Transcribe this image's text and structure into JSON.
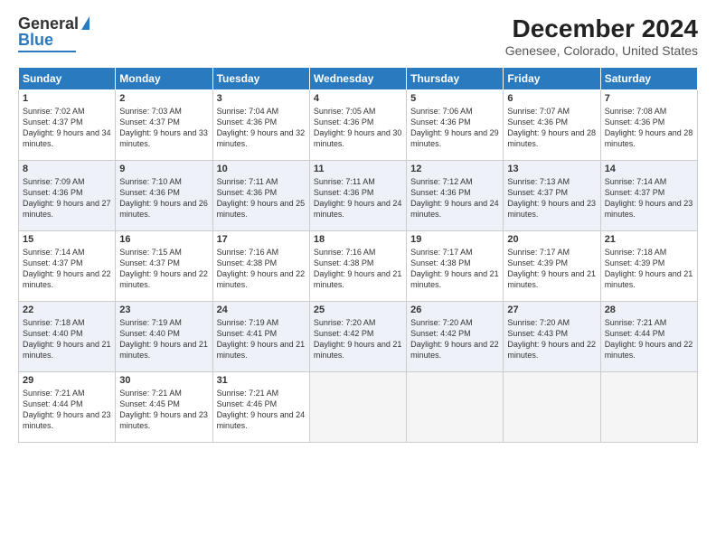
{
  "logo": {
    "line1": "General",
    "line2": "Blue"
  },
  "title": "December 2024",
  "subtitle": "Genesee, Colorado, United States",
  "days_of_week": [
    "Sunday",
    "Monday",
    "Tuesday",
    "Wednesday",
    "Thursday",
    "Friday",
    "Saturday"
  ],
  "weeks": [
    [
      {
        "day": "1",
        "sunrise": "7:02 AM",
        "sunset": "4:37 PM",
        "daylight": "9 hours and 34 minutes."
      },
      {
        "day": "2",
        "sunrise": "7:03 AM",
        "sunset": "4:37 PM",
        "daylight": "9 hours and 33 minutes."
      },
      {
        "day": "3",
        "sunrise": "7:04 AM",
        "sunset": "4:36 PM",
        "daylight": "9 hours and 32 minutes."
      },
      {
        "day": "4",
        "sunrise": "7:05 AM",
        "sunset": "4:36 PM",
        "daylight": "9 hours and 30 minutes."
      },
      {
        "day": "5",
        "sunrise": "7:06 AM",
        "sunset": "4:36 PM",
        "daylight": "9 hours and 29 minutes."
      },
      {
        "day": "6",
        "sunrise": "7:07 AM",
        "sunset": "4:36 PM",
        "daylight": "9 hours and 28 minutes."
      },
      {
        "day": "7",
        "sunrise": "7:08 AM",
        "sunset": "4:36 PM",
        "daylight": "9 hours and 28 minutes."
      }
    ],
    [
      {
        "day": "8",
        "sunrise": "7:09 AM",
        "sunset": "4:36 PM",
        "daylight": "9 hours and 27 minutes."
      },
      {
        "day": "9",
        "sunrise": "7:10 AM",
        "sunset": "4:36 PM",
        "daylight": "9 hours and 26 minutes."
      },
      {
        "day": "10",
        "sunrise": "7:11 AM",
        "sunset": "4:36 PM",
        "daylight": "9 hours and 25 minutes."
      },
      {
        "day": "11",
        "sunrise": "7:11 AM",
        "sunset": "4:36 PM",
        "daylight": "9 hours and 24 minutes."
      },
      {
        "day": "12",
        "sunrise": "7:12 AM",
        "sunset": "4:36 PM",
        "daylight": "9 hours and 24 minutes."
      },
      {
        "day": "13",
        "sunrise": "7:13 AM",
        "sunset": "4:37 PM",
        "daylight": "9 hours and 23 minutes."
      },
      {
        "day": "14",
        "sunrise": "7:14 AM",
        "sunset": "4:37 PM",
        "daylight": "9 hours and 23 minutes."
      }
    ],
    [
      {
        "day": "15",
        "sunrise": "7:14 AM",
        "sunset": "4:37 PM",
        "daylight": "9 hours and 22 minutes."
      },
      {
        "day": "16",
        "sunrise": "7:15 AM",
        "sunset": "4:37 PM",
        "daylight": "9 hours and 22 minutes."
      },
      {
        "day": "17",
        "sunrise": "7:16 AM",
        "sunset": "4:38 PM",
        "daylight": "9 hours and 22 minutes."
      },
      {
        "day": "18",
        "sunrise": "7:16 AM",
        "sunset": "4:38 PM",
        "daylight": "9 hours and 21 minutes."
      },
      {
        "day": "19",
        "sunrise": "7:17 AM",
        "sunset": "4:38 PM",
        "daylight": "9 hours and 21 minutes."
      },
      {
        "day": "20",
        "sunrise": "7:17 AM",
        "sunset": "4:39 PM",
        "daylight": "9 hours and 21 minutes."
      },
      {
        "day": "21",
        "sunrise": "7:18 AM",
        "sunset": "4:39 PM",
        "daylight": "9 hours and 21 minutes."
      }
    ],
    [
      {
        "day": "22",
        "sunrise": "7:18 AM",
        "sunset": "4:40 PM",
        "daylight": "9 hours and 21 minutes."
      },
      {
        "day": "23",
        "sunrise": "7:19 AM",
        "sunset": "4:40 PM",
        "daylight": "9 hours and 21 minutes."
      },
      {
        "day": "24",
        "sunrise": "7:19 AM",
        "sunset": "4:41 PM",
        "daylight": "9 hours and 21 minutes."
      },
      {
        "day": "25",
        "sunrise": "7:20 AM",
        "sunset": "4:42 PM",
        "daylight": "9 hours and 21 minutes."
      },
      {
        "day": "26",
        "sunrise": "7:20 AM",
        "sunset": "4:42 PM",
        "daylight": "9 hours and 22 minutes."
      },
      {
        "day": "27",
        "sunrise": "7:20 AM",
        "sunset": "4:43 PM",
        "daylight": "9 hours and 22 minutes."
      },
      {
        "day": "28",
        "sunrise": "7:21 AM",
        "sunset": "4:44 PM",
        "daylight": "9 hours and 22 minutes."
      }
    ],
    [
      {
        "day": "29",
        "sunrise": "7:21 AM",
        "sunset": "4:44 PM",
        "daylight": "9 hours and 23 minutes."
      },
      {
        "day": "30",
        "sunrise": "7:21 AM",
        "sunset": "4:45 PM",
        "daylight": "9 hours and 23 minutes."
      },
      {
        "day": "31",
        "sunrise": "7:21 AM",
        "sunset": "4:46 PM",
        "daylight": "9 hours and 24 minutes."
      },
      null,
      null,
      null,
      null
    ]
  ],
  "labels": {
    "sunrise": "Sunrise: ",
    "sunset": "Sunset: ",
    "daylight": "Daylight: "
  }
}
